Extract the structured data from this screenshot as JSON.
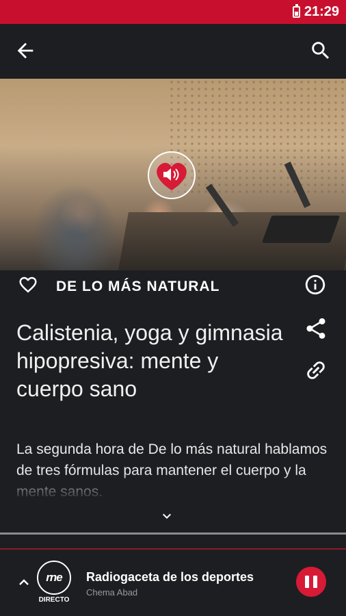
{
  "status_bar": {
    "time": "21:29"
  },
  "program": {
    "name": "DE LO MÁS NATURAL"
  },
  "episode": {
    "title": "Calistenia, yoga y gimnasia hipopresiva: mente y cuerpo sano",
    "description": "La segunda hora de De lo más natural hablamos de tres fórmulas para mantener el cuerpo y la mente sanos."
  },
  "player": {
    "station_logo": "rne",
    "station_sub": "DIRECTO",
    "now_playing_title": "Radiogaceta de los deportes",
    "now_playing_subtitle": "Chema Abad"
  },
  "colors": {
    "accent": "#c8102e",
    "background": "#1d1e22",
    "pause_button": "#d71a35"
  },
  "icons": [
    "back-arrow-icon",
    "search-icon",
    "heart-icon",
    "info-icon",
    "share-icon",
    "link-icon",
    "chevron-down-icon",
    "chevron-up-icon",
    "pause-icon",
    "battery-icon"
  ]
}
